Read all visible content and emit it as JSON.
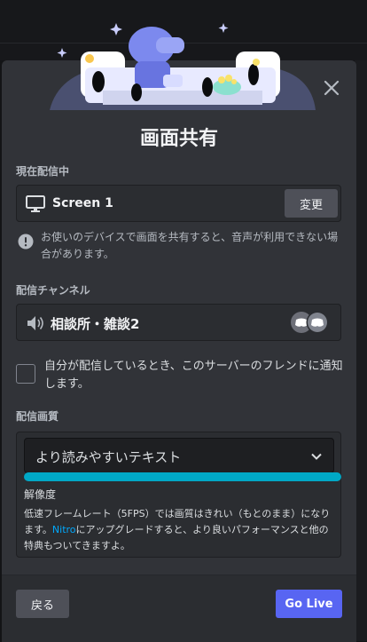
{
  "dialog": {
    "title": "画面共有",
    "close_icon": "close-icon"
  },
  "current_stream": {
    "label": "現在配信中",
    "source_name": "Screen 1",
    "change_label": "変更",
    "note": "お使いのデバイスで画面を共有すると、音声が利用できない場合があります。"
  },
  "channel": {
    "label": "配信チャンネル",
    "name": "相談所・雑談2"
  },
  "friends_notify": {
    "text": "自分が配信しているとき、このサーバーのフレンドに通知します。",
    "checked": false
  },
  "quality": {
    "label": "配信画質",
    "selected": "より読みやすいテキスト",
    "resolution_label": "解像度",
    "desc_before": "低速フレームレート（5FPS）では画質はきれい（もとのまま）になります。",
    "nitro_link": "Nitro",
    "desc_after": "にアップグレードすると、より良いパフォーマンスと他の特典もついてきますよ。",
    "accent_color": "#00a8c6"
  },
  "footer": {
    "back_label": "戻る",
    "golive_label": "Go Live",
    "primary_color": "#5865f2"
  }
}
